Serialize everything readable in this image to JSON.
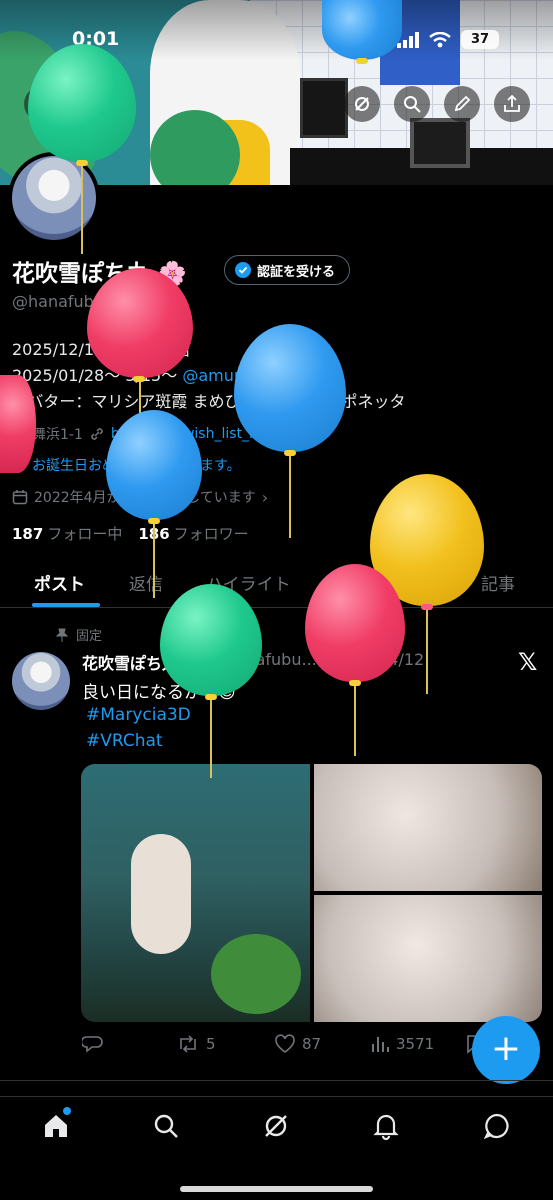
{
  "status_bar": {
    "time": "0:01",
    "battery": "37"
  },
  "profile": {
    "display_name": "花吹雪ぽち丸 🌸",
    "verify_label": "認証を受ける",
    "handle": "@hanafubukipoth",
    "bio_line1": "2025/12/14～VRC 開始",
    "bio_line2_prefix": "2025/01/28～ 3/15～ ",
    "bio_line2_mention": "@amupondayo",
    "bio_line3": "アバター：マリシア斑霞 まめひなた フワリポポネッタ",
    "location": "舞浜1-1",
    "website": "booth.pm/wish_list_name...",
    "birthday": "お誕生日おめでとうございます。",
    "joined": "2022年4月からXを利用しています",
    "following_count": "187",
    "following_label": "フォロー中",
    "followers_count": "186",
    "followers_label": "フォロワー"
  },
  "tabs": [
    "ポスト",
    "返信",
    "ハイライト",
    "動画",
    "画像",
    "記事"
  ],
  "post": {
    "pinned_label": "固定",
    "name": "花吹雪ぽち丸 🍀",
    "meta": "@hanafubu... · 2026/04/12",
    "text": "良い日になるかな😌",
    "tag1": "#Marycia3D",
    "tag2": "#VRChat",
    "retweets": "5",
    "likes": "87",
    "views": "3571"
  },
  "colors": {
    "accent": "#1d9bf0",
    "muted": "#71767b",
    "background": "#000000"
  },
  "icons": {
    "banner_actions": [
      "back-arrow-icon",
      "brand-icon",
      "search-icon",
      "edit-icon",
      "share-icon"
    ],
    "bottom_nav": [
      "home-icon",
      "search-icon",
      "grok-icon",
      "notifications-icon",
      "messages-icon"
    ]
  }
}
